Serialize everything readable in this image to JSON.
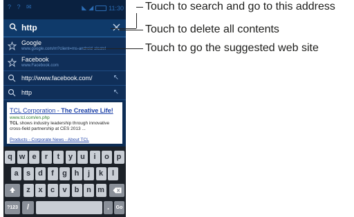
{
  "status_bar": {
    "left_icons": "? ? ✉",
    "time": "11:30"
  },
  "search": {
    "value": "http"
  },
  "suggestions": [
    {
      "title": "Google",
      "subtitle": "www.google.com/m?client=ms-android-alcatel",
      "icon": "star-icon"
    },
    {
      "title": "Facebook",
      "subtitle": "www.Facebook.com",
      "icon": "star-icon"
    },
    {
      "title": "http://www.facebook.com/",
      "icon": "search-icon"
    },
    {
      "title": "http",
      "icon": "search-icon"
    }
  ],
  "web_result": {
    "title_brand": "TCL",
    "title_rest": " Corporation - ",
    "title_bold": "The Creative Life!",
    "url": "www.tcl.com/en.php",
    "desc_brand": "TCL",
    "desc_rest": " shows industry leadership through innovative cross-field partnership at CES 2013 ...",
    "links": "Products - Corporate News - About TCL"
  },
  "keyboard": {
    "row1": [
      "q",
      "w",
      "e",
      "r",
      "t",
      "y",
      "u",
      "i",
      "o",
      "p"
    ],
    "row2": [
      "a",
      "s",
      "d",
      "f",
      "g",
      "h",
      "j",
      "k",
      "l"
    ],
    "row3": [
      "z",
      "x",
      "c",
      "v",
      "b",
      "n",
      "m"
    ],
    "key_123": "?123",
    "key_slash": "/",
    "key_period": ".",
    "key_go": "Go"
  },
  "callouts": {
    "search": "Touch to search and go to this address",
    "delete": "Touch to delete all contents",
    "suggested": "Touch to go the suggested web site"
  }
}
